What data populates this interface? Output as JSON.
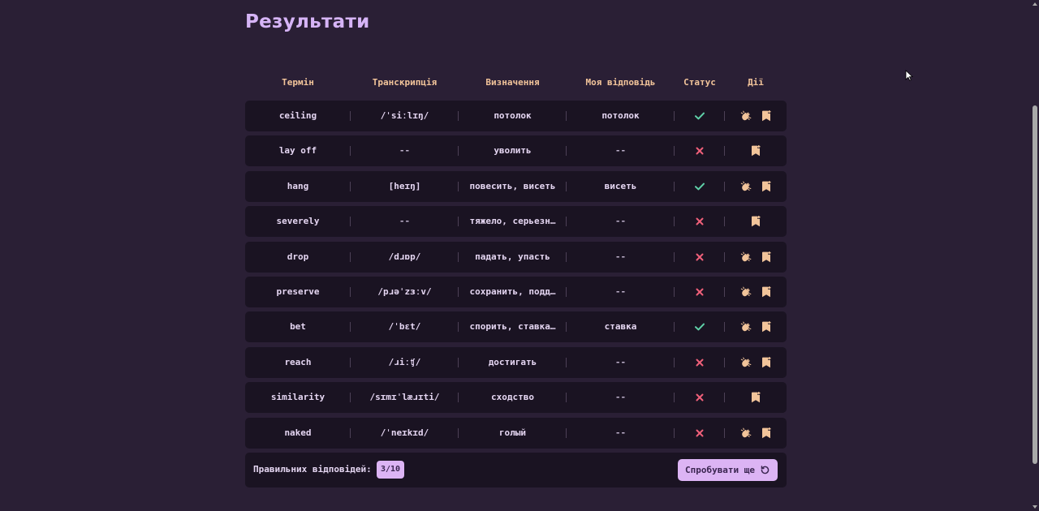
{
  "title": "Результати",
  "headers": [
    "Термін",
    "Транскрипція",
    "Визначення",
    "Моя відповідь",
    "Статус",
    "Дії"
  ],
  "rows": [
    {
      "term": "ceiling",
      "transcription": "/ˈsiːlɪŋ/",
      "definition": "потолок",
      "answer": "потолок",
      "status": "correct",
      "has_audio": true
    },
    {
      "term": "lay off",
      "transcription": "--",
      "definition": "уволить",
      "answer": "--",
      "status": "wrong",
      "has_audio": false
    },
    {
      "term": "hang",
      "transcription": "[heɪŋ]",
      "definition": "повесить, висеть",
      "answer": "висеть",
      "status": "correct",
      "has_audio": true
    },
    {
      "term": "severely",
      "transcription": "--",
      "definition": "тяжело, серьезн…",
      "answer": "--",
      "status": "wrong",
      "has_audio": false
    },
    {
      "term": "drop",
      "transcription": "/dɹɒp/",
      "definition": "падать, упасть",
      "answer": "--",
      "status": "wrong",
      "has_audio": true
    },
    {
      "term": "preserve",
      "transcription": "/pɹəˈzɜːv/",
      "definition": "сохранить, подд…",
      "answer": "--",
      "status": "wrong",
      "has_audio": true
    },
    {
      "term": "bet",
      "transcription": "/ˈbɛt/",
      "definition": "спорить, ставка…",
      "answer": "ставка",
      "status": "correct",
      "has_audio": true
    },
    {
      "term": "reach",
      "transcription": "/ɹiːʧ/",
      "definition": "достигать",
      "answer": "--",
      "status": "wrong",
      "has_audio": true
    },
    {
      "term": "similarity",
      "transcription": "/sɪmɪˈlæɹɪti/",
      "definition": "сходство",
      "answer": "--",
      "status": "wrong",
      "has_audio": false
    },
    {
      "term": "naked",
      "transcription": "/ˈneɪkɪd/",
      "definition": "голый",
      "answer": "--",
      "status": "wrong",
      "has_audio": true
    }
  ],
  "footer": {
    "score_label": "Правильних відповідей:",
    "score_value": "3/10",
    "retry_label": "Спробувати ще"
  },
  "icons": {
    "correct": "check-icon",
    "wrong": "cross-icon",
    "audio": "speaker-icon",
    "bookmark": "bookmark-add-icon"
  },
  "colors": {
    "background": "#2a1f35",
    "row_bg": "#1a1322",
    "title": "#d6b4f7",
    "header_text": "#f2c49a",
    "accent": "#dcb4f4",
    "correct": "#5fd0a8",
    "wrong": "#f0607a",
    "icon": "#f2c49a"
  }
}
